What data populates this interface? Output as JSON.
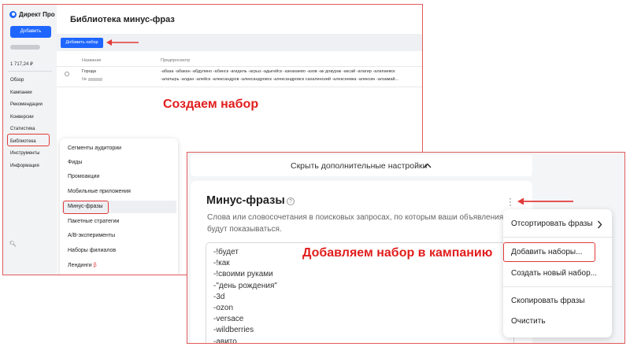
{
  "library": {
    "brand": "Директ Про",
    "add_button": "Добавить",
    "balance": "1 717,24 ₽",
    "nav": [
      "Обзор",
      "Кампании",
      "Рекомендации",
      "Конверсии",
      "Статистика",
      "Библиотека",
      "Инструменты",
      "Информация"
    ],
    "title": "Библиотека минус-фраз",
    "add_set_button": "Добавить набор",
    "columns": {
      "name": "Название",
      "preview": "Предпросмотр"
    },
    "row": {
      "name": "Города",
      "number_prefix": "№",
      "preview_line1": "-абаза -абакан -абдулино -абинск -агидель -агрыз -адыгейск -азнакаево -азов -ак довурак -аксай -алагир -алапаевск",
      "preview_line2": "-алатырь -алдан -алейск -александров -александровск -александровск сахалинский -алексеевка -алексин -алзамай..."
    },
    "dropdown": [
      "Сегменты аудитории",
      "Фиды",
      "Промоакции",
      "Мобильные приложения",
      "Минус-фразы",
      "Пакетные стратегии",
      "A/B-эксперименты",
      "Наборы филиалов",
      "Лендинги"
    ],
    "dropdown_marker": "β"
  },
  "annotations": {
    "create": "Создаем набор",
    "add_to_campaign": "Добавляем набор в кампанию"
  },
  "campaign": {
    "advanced_toggle": "Скрыть дополнительные настройки",
    "section_title": "Минус-фразы",
    "help_icon": "?",
    "description": "Слова или словосочетания в поисковых запросах, по которым ваши объявления не будут показываться.",
    "phrases": [
      "-!будет",
      "-!как",
      "-!своими руками",
      "-\"день рождения\"",
      "-3d",
      "-ozon",
      "-versace",
      "-wildberries",
      "-авито"
    ],
    "menu": [
      "Отсортировать фразы",
      "Добавить наборы...",
      "Создать новый набор...",
      "Скопировать фразы",
      "Очистить"
    ]
  },
  "colors": {
    "accent": "#1e66ff",
    "annotation_red": "#e21d1d"
  }
}
